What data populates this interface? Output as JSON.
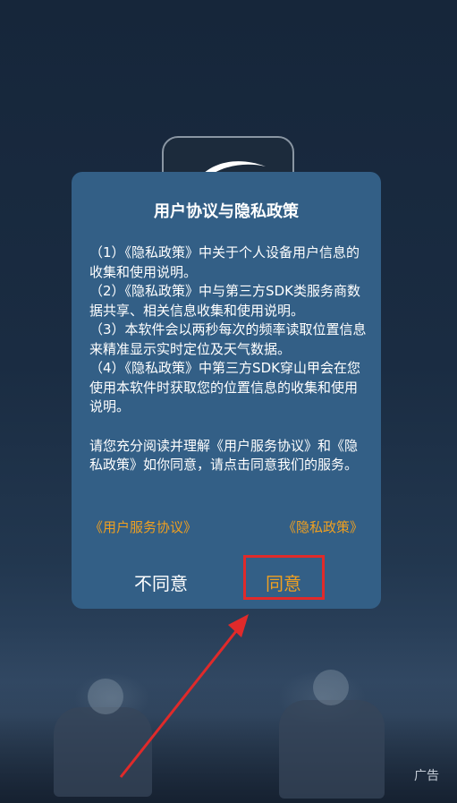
{
  "dialog": {
    "title": "用户协议与隐私政策",
    "paragraphs": [
      "（1）《隐私政策》中关于个人设备用户信息的收集和使用说明。",
      "（2）《隐私政策》中与第三方SDK类服务商数据共享、相关信息收集和使用说明。",
      "（3）本软件会以两秒每次的频率读取位置信息来精准显示实时定位及天气数据。",
      "（4）《隐私政策》中第三方SDK穿山甲会在您使用本软件时获取您的位置信息的收集和使用说明。",
      "请您充分阅读并理解《用户服务协议》和《隐私政策》如你同意，请点击同意我们的服务。"
    ],
    "links": {
      "user_agreement": "《用户服务协议》",
      "privacy_policy": "《隐私政策》"
    },
    "buttons": {
      "disagree": "不同意",
      "agree": "同意"
    }
  },
  "background": {
    "ad_label": "广告"
  },
  "colors": {
    "dialog_bg": "#335f86",
    "accent": "#f0a020",
    "highlight": "#e02a2a"
  }
}
